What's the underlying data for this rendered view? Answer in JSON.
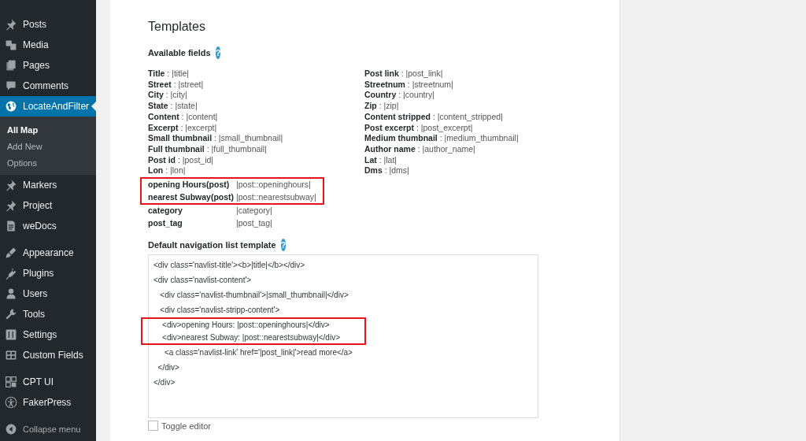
{
  "sidebar": {
    "groups": [
      [
        {
          "label": "Posts",
          "selected": false
        },
        {
          "label": "Media",
          "selected": false
        },
        {
          "label": "Pages",
          "selected": false
        },
        {
          "label": "Comments",
          "selected": false
        },
        {
          "label": "LocateAndFilter",
          "selected": true,
          "submenu": [
            {
              "label": "All Map",
              "selected": true
            },
            {
              "label": "Add New",
              "selected": false
            },
            {
              "label": "Options",
              "selected": false
            }
          ]
        },
        {
          "label": "Markers",
          "selected": false
        },
        {
          "label": "Project",
          "selected": false
        },
        {
          "label": "weDocs",
          "selected": false
        }
      ],
      [
        {
          "label": "Appearance",
          "selected": false
        },
        {
          "label": "Plugins",
          "selected": false
        },
        {
          "label": "Users",
          "selected": false
        },
        {
          "label": "Tools",
          "selected": false
        },
        {
          "label": "Settings",
          "selected": false
        },
        {
          "label": "Custom Fields",
          "selected": false
        }
      ],
      [
        {
          "label": "CPT UI",
          "selected": false
        },
        {
          "label": "FakerPress",
          "selected": false
        }
      ]
    ],
    "collapse_label": "Collapse menu"
  },
  "templates": {
    "title": "Templates",
    "available_fields": {
      "title": "Available fields",
      "help": "?",
      "left": [
        "**Title** : |title|",
        "**Street** : |street|",
        "**City** : |city|",
        "**State** : |state|",
        "**Content** : |content|",
        "**Excerpt** : |excerpt|",
        "**Small thumbnail** : |small_thumbnail|",
        "**Full thumbnail** : |full_thumbnail|",
        "**Post id** : |post_id|",
        "**Lon** : |lon|"
      ],
      "right": [
        "**Post link** : |post_link|",
        "**Streetnum** : |streetnum|",
        "**Country** : |country|",
        "**Zip** : |zip|",
        "**Content stripped** : |content_stripped|",
        "**Post excerpt** : |post_excerpt|",
        "**Medium thumbnail** : |medium_thumbnail|",
        "**Author name** : |author_name|",
        "**Lat** : |lat|",
        "**Dms** : |dms|"
      ],
      "highlighted_custom": [
        {
          "label": "opening Hours(post)",
          "value": "|post::openinghours|"
        },
        {
          "label": "nearest Subway(post)",
          "value": "|post::nearestsubway|"
        }
      ],
      "custom": [
        {
          "label": "category",
          "value": "|category|"
        },
        {
          "label": "post_tag",
          "value": "|post_tag|"
        }
      ]
    },
    "navigation_template": {
      "title": "Default navigation list template",
      "help": "?",
      "lines_before": [
        "<div class='navlist-title'><b>|title|</b></div>",
        "<div class='navlist-content'>",
        "   <div class='navlist-thumbnail'>|small_thumbnail|</div>",
        "   <div class='navlist-stripp-content'>"
      ],
      "highlighted_lines": [
        "    <div>opening Hours: |post::openinghours|</div>",
        "    <div>nearest Subway: |post::nearestsubway|</div>"
      ],
      "lines_after": [
        "     <a class='navlist-link' href='|post_link|'>read more</a>",
        "  </div>",
        "</div>"
      ]
    },
    "toggle_editor": {
      "label": "Toggle editor",
      "checked": false
    }
  }
}
